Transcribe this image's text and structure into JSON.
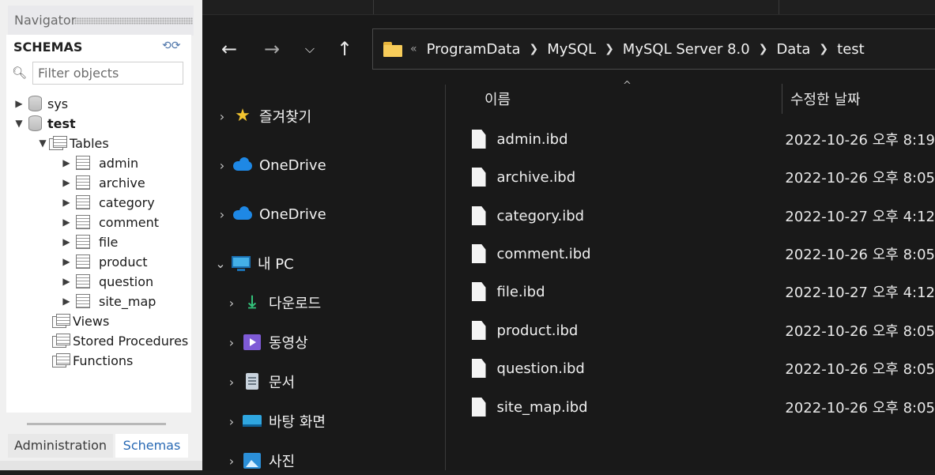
{
  "navigator": {
    "title": "Navigator",
    "section_title": "SCHEMAS",
    "filter_placeholder": "Filter objects",
    "schemas": [
      {
        "label": "sys"
      },
      {
        "label": "test"
      }
    ],
    "tables_folder": "Tables",
    "tables": [
      "admin",
      "archive",
      "category",
      "comment",
      "file",
      "product",
      "question",
      "site_map"
    ],
    "views_folder": "Views",
    "procedures_folder": "Stored Procedures",
    "functions_folder": "Functions",
    "tabs": [
      "Administration",
      "Schemas"
    ]
  },
  "explorer": {
    "breadcrumb": [
      "ProgramData",
      "MySQL",
      "MySQL Server 8.0",
      "Data",
      "test"
    ],
    "overflow": "«",
    "nav_tree": [
      {
        "label": "즐겨찾기",
        "icon": "star-icon"
      },
      {
        "label": "OneDrive",
        "icon": "cloud-icon"
      },
      {
        "label": "OneDrive",
        "icon": "cloud-icon"
      },
      {
        "label": "내 PC",
        "icon": "pc-icon"
      },
      {
        "label": "다운로드",
        "icon": "download-icon"
      },
      {
        "label": "동영상",
        "icon": "video-icon"
      },
      {
        "label": "문서",
        "icon": "document-icon"
      },
      {
        "label": "바탕 화면",
        "icon": "desktop-icon"
      },
      {
        "label": "사진",
        "icon": "photo-icon"
      }
    ],
    "columns": {
      "name": "이름",
      "modified": "수정한 날짜"
    },
    "files": [
      {
        "name": "admin.ibd",
        "modified": "2022-10-26 오후 8:19"
      },
      {
        "name": "archive.ibd",
        "modified": "2022-10-26 오후 8:05"
      },
      {
        "name": "category.ibd",
        "modified": "2022-10-27 오후 4:12"
      },
      {
        "name": "comment.ibd",
        "modified": "2022-10-26 오후 8:05"
      },
      {
        "name": "file.ibd",
        "modified": "2022-10-27 오후 4:12"
      },
      {
        "name": "product.ibd",
        "modified": "2022-10-26 오후 8:05"
      },
      {
        "name": "question.ibd",
        "modified": "2022-10-26 오후 8:05"
      },
      {
        "name": "site_map.ibd",
        "modified": "2022-10-26 오후 8:05"
      }
    ]
  }
}
